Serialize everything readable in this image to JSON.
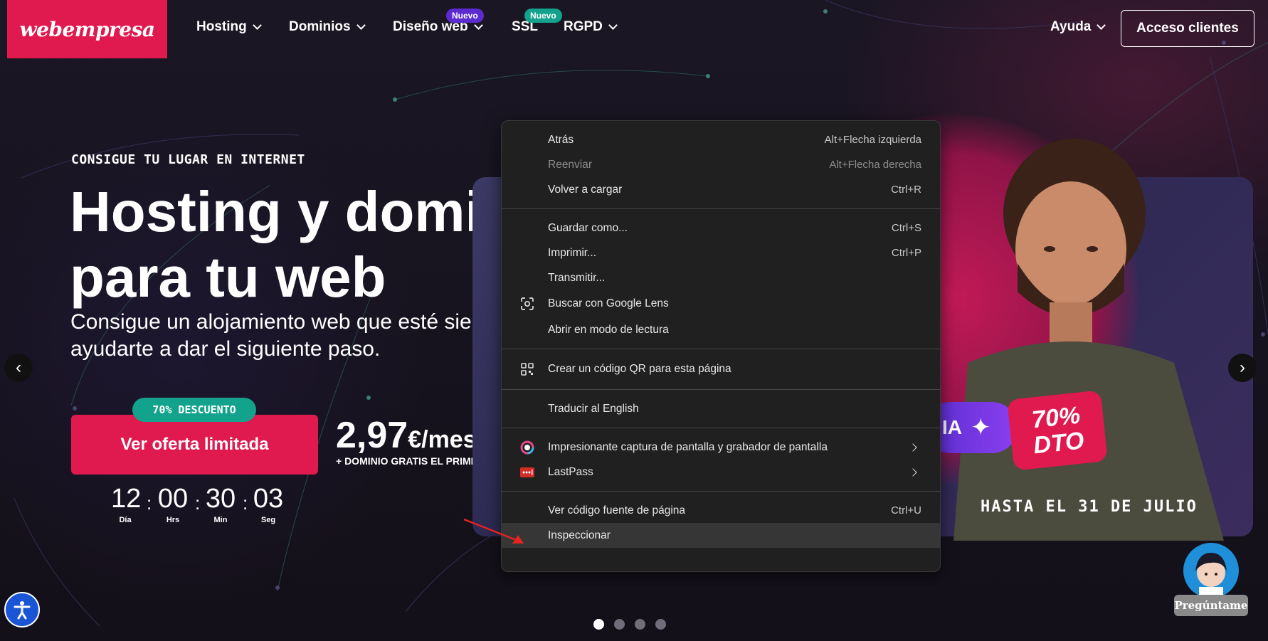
{
  "header": {
    "logo": "webempresa",
    "nav": [
      {
        "label": "Hosting",
        "has_dropdown": true
      },
      {
        "label": "Dominios",
        "has_dropdown": true
      },
      {
        "label": "Diseño web",
        "has_dropdown": true,
        "badge": "Nuevo"
      },
      {
        "label": "SSL",
        "has_dropdown": false,
        "badge": "Nuevo"
      },
      {
        "label": "RGPD",
        "has_dropdown": true
      }
    ],
    "help": "Ayuda",
    "client_access": "Acceso clientes"
  },
  "hero": {
    "eyebrow": "CONSIGUE TU LUGAR EN INTERNET",
    "title_line1": "Hosting y domin",
    "title_line2": "para tu web",
    "subtitle_line1": "Consigue un alojamiento web que esté siemp",
    "subtitle_line2": "ayudarte a dar el siguiente paso.",
    "discount_pill": "70% DESCUENTO",
    "cta": "Ver oferta limitada",
    "price": "2,97",
    "price_unit": "€/mes",
    "price_note": "+ DOMINIO GRATIS EL PRIMER AÑ",
    "countdown": [
      {
        "value": "12",
        "label": "Día"
      },
      {
        "value": "00",
        "label": "Hrs"
      },
      {
        "value": "30",
        "label": "Min"
      },
      {
        "value": "03",
        "label": "Seg"
      }
    ]
  },
  "promo": {
    "ia_label": "IA",
    "dto_line1": "70%",
    "dto_line2": "DTO",
    "until": "HASTA EL 31 DE JULIO"
  },
  "carousel": {
    "slides": 4,
    "active": 0
  },
  "chat": {
    "label": "Pregúntame"
  },
  "context_menu": {
    "groups": [
      [
        {
          "label": "Atrás",
          "shortcut": "Alt+Flecha izquierda",
          "enabled": true
        },
        {
          "label": "Reenviar",
          "shortcut": "Alt+Flecha derecha",
          "enabled": false
        },
        {
          "label": "Volver a cargar",
          "shortcut": "Ctrl+R",
          "enabled": true
        }
      ],
      [
        {
          "label": "Guardar como...",
          "shortcut": "Ctrl+S",
          "enabled": true
        },
        {
          "label": "Imprimir...",
          "shortcut": "Ctrl+P",
          "enabled": true
        },
        {
          "label": "Transmitir...",
          "shortcut": "",
          "enabled": true
        },
        {
          "label": "Buscar con Google Lens",
          "shortcut": "",
          "enabled": true,
          "icon": "google-lens-icon"
        },
        {
          "label": "Abrir en modo de lectura",
          "shortcut": "",
          "enabled": true
        }
      ],
      [
        {
          "label": "Crear un código QR para esta página",
          "shortcut": "",
          "enabled": true,
          "icon": "qr-code-icon"
        }
      ],
      [
        {
          "label": "Traducir al English",
          "shortcut": "",
          "enabled": true
        }
      ],
      [
        {
          "label": "Impresionante captura de pantalla y grabador de pantalla",
          "shortcut": "",
          "enabled": true,
          "icon": "screenshot-extension-icon",
          "submenu": true
        },
        {
          "label": "LastPass",
          "shortcut": "",
          "enabled": true,
          "icon": "lastpass-icon",
          "submenu": true
        }
      ],
      [
        {
          "label": "Ver código fuente de página",
          "shortcut": "Ctrl+U",
          "enabled": true
        },
        {
          "label": "Inspeccionar",
          "shortcut": "",
          "enabled": true,
          "hovered": true
        }
      ]
    ]
  },
  "colors": {
    "brand": "#e0194f",
    "teal": "#13a38c",
    "purple_badge": "#5b2bd0",
    "menu_bg": "#202020"
  }
}
